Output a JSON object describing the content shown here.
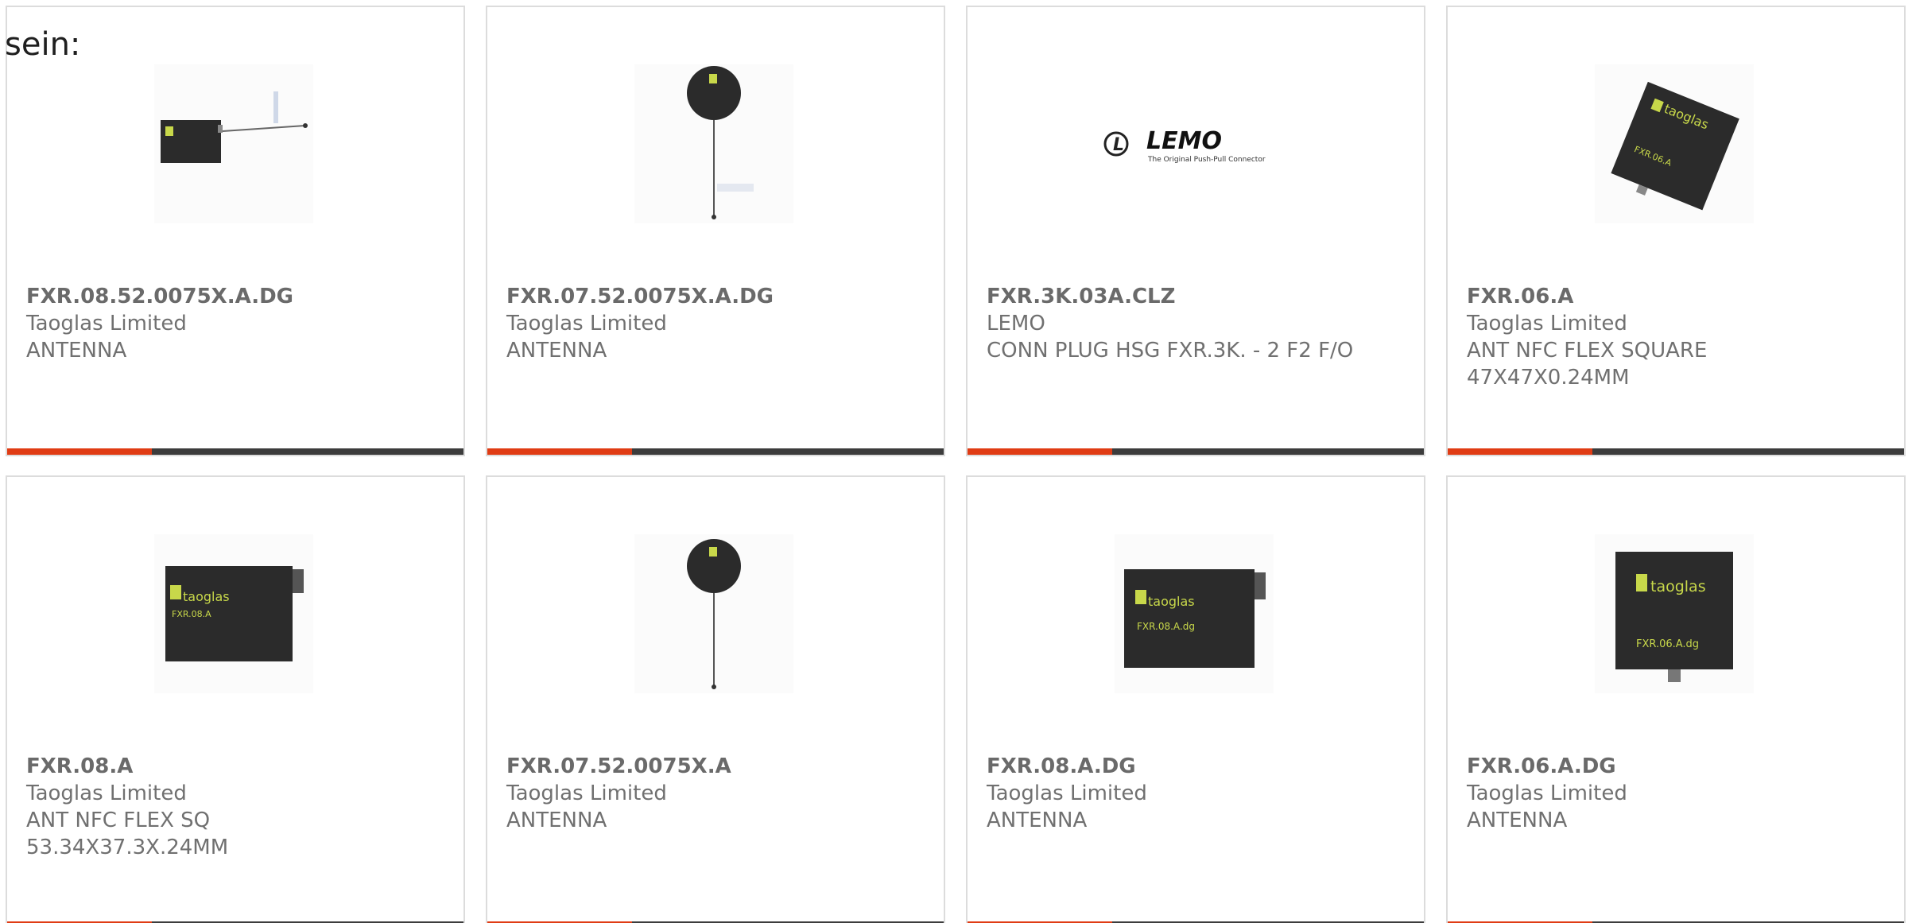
{
  "intro_text": "sein:",
  "colors": {
    "accent": "#e03c14",
    "bar": "#3c3c3c",
    "border": "#dcdcdc",
    "text": "#707070",
    "logo_green": "#c8d84a"
  },
  "products": [
    {
      "part_number": "FXR.08.52.0075X.A.DG",
      "manufacturer": "Taoglas Limited",
      "description": "ANTENNA",
      "image": "rectangular-flex-antenna-with-cable"
    },
    {
      "part_number": "FXR.07.52.0075X.A.DG",
      "manufacturer": "Taoglas Limited",
      "description": "ANTENNA",
      "image": "round-flex-antenna-with-cable"
    },
    {
      "part_number": "FXR.3K.03A.CLZ",
      "manufacturer": "LEMO",
      "description": "CONN PLUG HSG FXR.3K. - 2 F2 F/O",
      "image": "lemo-logo",
      "logo_text": "LEMO",
      "logo_tagline": "The Original Push-Pull Connector"
    },
    {
      "part_number": "FXR.06.A",
      "manufacturer": "Taoglas Limited",
      "description": "ANT NFC FLEX SQUARE 47X47X0.24MM",
      "image": "square-flex-antenna-rotated",
      "label": "FXR.06.A",
      "brand": "taoglas"
    },
    {
      "part_number": "FXR.08.A",
      "manufacturer": "Taoglas Limited",
      "description": "ANT NFC FLEX SQ 53.34X37.3X.24MM",
      "image": "rectangular-flex-antenna",
      "label": "FXR.08.A",
      "brand": "taoglas"
    },
    {
      "part_number": "FXR.07.52.0075X.A",
      "manufacturer": "Taoglas Limited",
      "description": "ANTENNA",
      "image": "round-flex-antenna-with-cable"
    },
    {
      "part_number": "FXR.08.A.DG",
      "manufacturer": "Taoglas Limited",
      "description": "ANTENNA",
      "image": "rectangular-flex-antenna",
      "label": "FXR.08.A.dg",
      "brand": "taoglas"
    },
    {
      "part_number": "FXR.06.A.DG",
      "manufacturer": "Taoglas Limited",
      "description": "ANTENNA",
      "image": "square-flex-antenna",
      "label": "FXR.06.A.dg",
      "brand": "taoglas"
    }
  ]
}
